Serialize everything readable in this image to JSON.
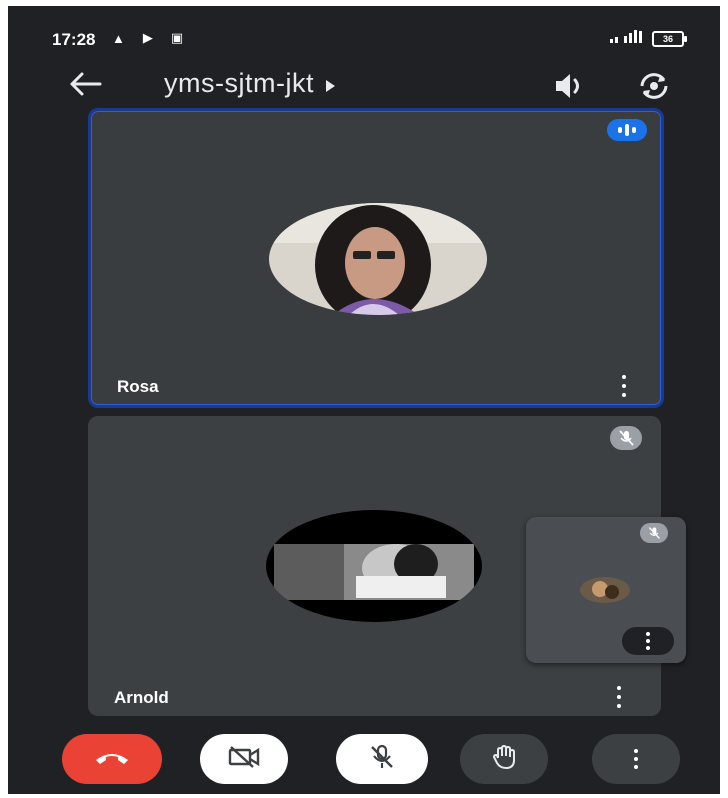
{
  "status_bar": {
    "time": "17:28",
    "battery": "36"
  },
  "header": {
    "meeting_code": "yms-sjtm-jkt"
  },
  "participants": [
    {
      "name": "Rosa",
      "speaking": true,
      "muted": false
    },
    {
      "name": "Arnold",
      "speaking": false,
      "muted": true
    }
  ],
  "self_view": {
    "muted": true
  },
  "controls": [
    {
      "icon": "end-call-icon"
    },
    {
      "icon": "camera-off-icon"
    },
    {
      "icon": "mic-off-icon"
    },
    {
      "icon": "raise-hand-icon"
    },
    {
      "icon": "more-options-icon"
    }
  ],
  "colors": {
    "background": "#202124",
    "tile": "#3c4043",
    "active_border": "#1a3a8f",
    "end_call": "#ea4335",
    "speaking": "#1a73e8"
  }
}
